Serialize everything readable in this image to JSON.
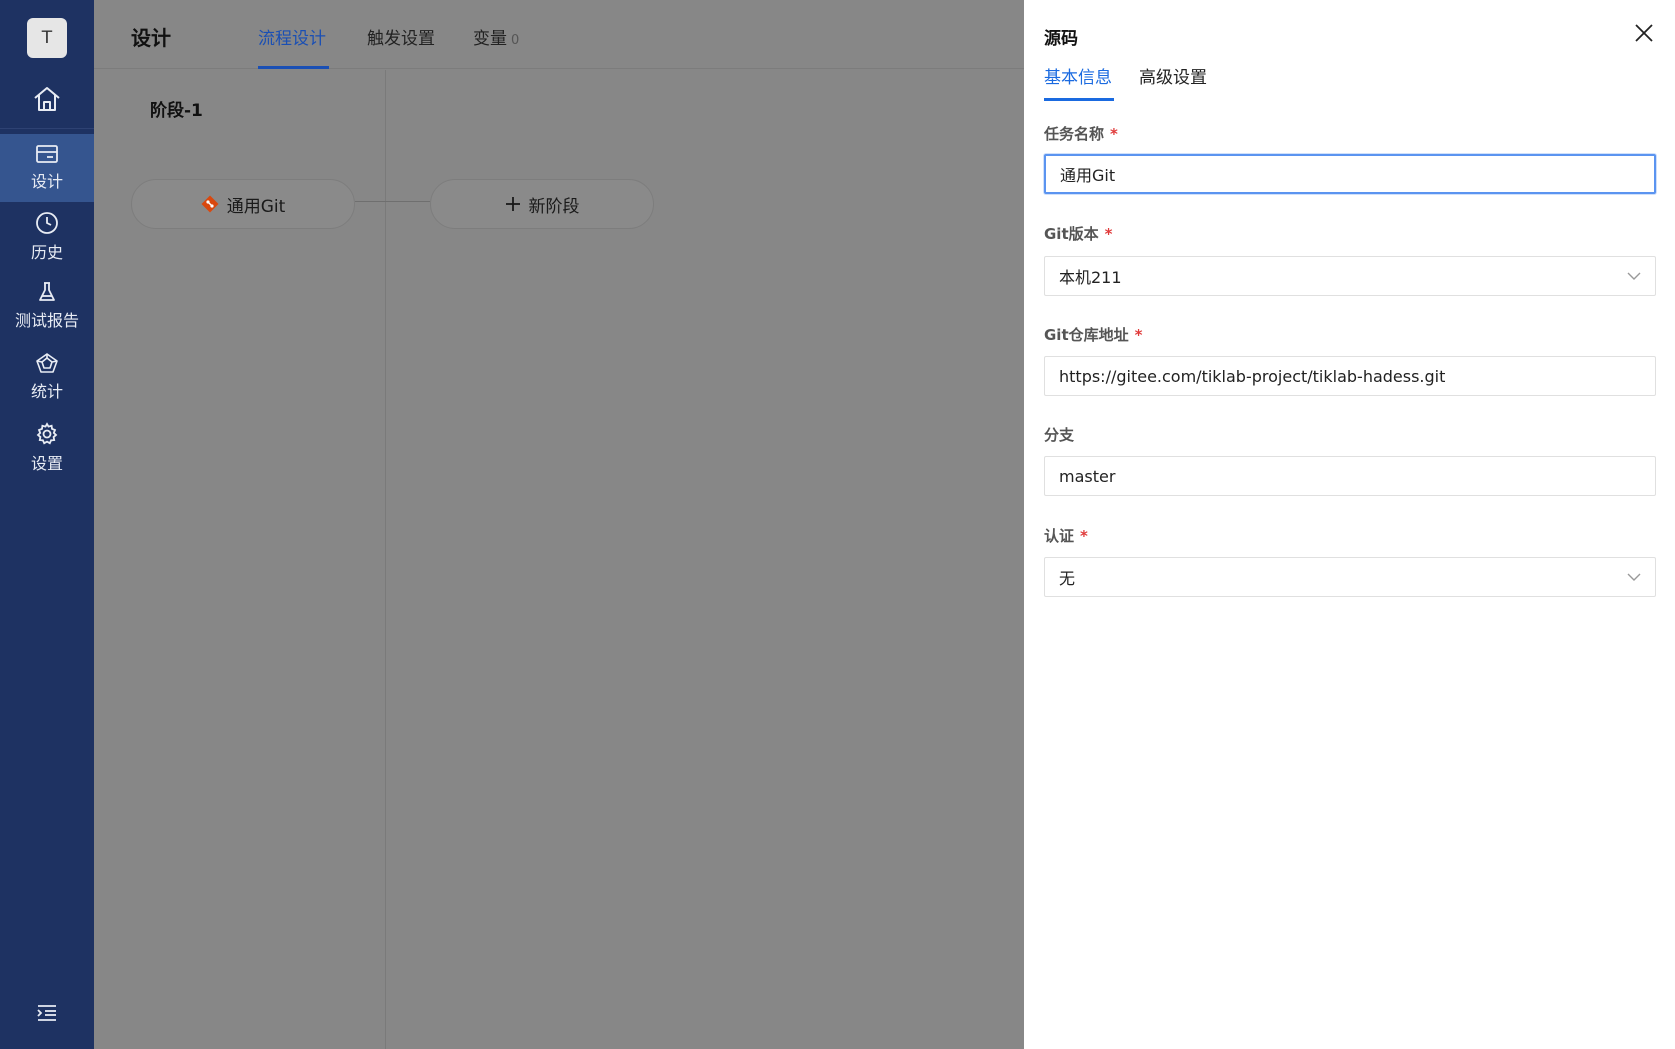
{
  "sidebar": {
    "avatar_letter": "T",
    "items": [
      {
        "label": "设计",
        "icon": "card-icon",
        "active": true
      },
      {
        "label": "历史",
        "icon": "clock-icon",
        "active": false
      },
      {
        "label": "测试报告",
        "icon": "flask-icon",
        "active": false
      },
      {
        "label": "统计",
        "icon": "pentagon-icon",
        "active": false
      },
      {
        "label": "设置",
        "icon": "gear-icon",
        "active": false
      }
    ]
  },
  "header": {
    "title": "设计",
    "tabs": [
      {
        "label": "流程设计",
        "active": true
      },
      {
        "label": "触发设置",
        "active": false
      },
      {
        "label": "变量",
        "count": "0",
        "active": false
      }
    ]
  },
  "canvas": {
    "stage_title": "阶段-1",
    "task_node_label": "通用Git",
    "new_stage_label": "新阶段"
  },
  "drawer": {
    "title": "源码",
    "tabs": [
      {
        "label": "基本信息",
        "active": true
      },
      {
        "label": "高级设置",
        "active": false
      }
    ],
    "fields": {
      "task_name": {
        "label": "任务名称",
        "value": "通用Git",
        "required_mark": "*"
      },
      "git_version": {
        "label": "Git版本",
        "value": "本机211",
        "required_mark": "*"
      },
      "git_repo": {
        "label": "Git仓库地址",
        "value": "https://gitee.com/tiklab-project/tiklab-hadess.git",
        "required_mark": "*"
      },
      "branch": {
        "label": "分支",
        "value": "master"
      },
      "auth": {
        "label": "认证",
        "value": "无",
        "required_mark": "*"
      }
    }
  },
  "colors": {
    "sidebar_bg": "#1e3262",
    "sidebar_active": "#35558f",
    "accent": "#1a6ae0",
    "required": "#e03b3b",
    "git_icon": "#d9480f"
  }
}
